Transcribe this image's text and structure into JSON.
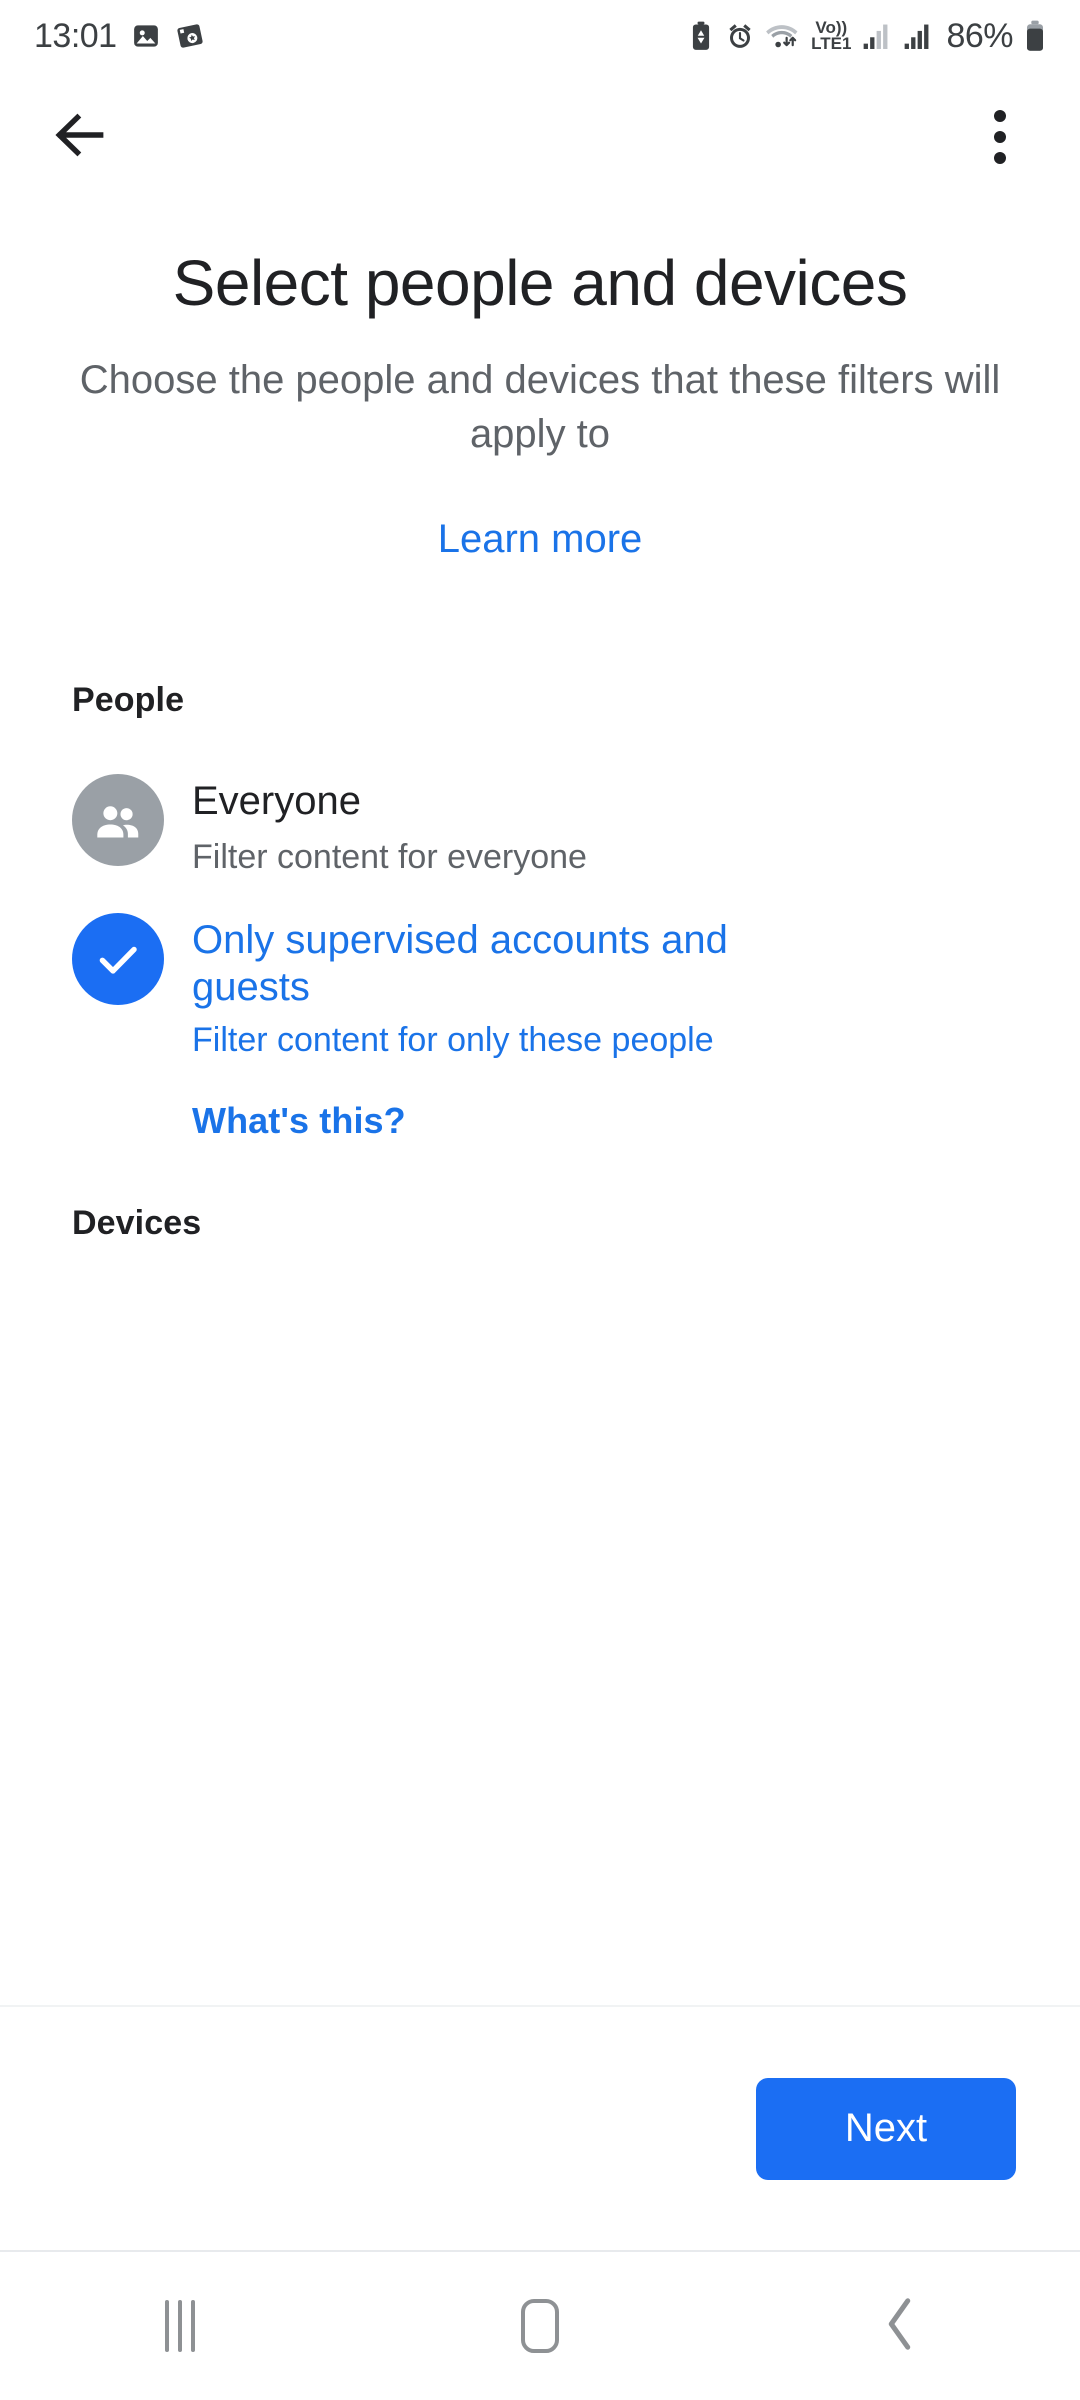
{
  "status_bar": {
    "time": "13:01",
    "battery_percent": "86%",
    "left_icons": [
      "photo-icon",
      "screenshot-capture-icon"
    ],
    "right_icons": [
      "battery-saver-icon",
      "alarm-icon",
      "wifi-icon",
      "volte-icon",
      "signal-sim1-icon",
      "signal-sim2-icon",
      "battery-icon"
    ],
    "network_label": "Vo))",
    "network_label2": "LTE1"
  },
  "toolbar": {
    "back_icon": "back-arrow-icon",
    "overflow_icon": "overflow-menu-icon"
  },
  "header": {
    "title": "Select people and devices",
    "subtitle": "Choose the people and devices that these filters will apply to",
    "learn_more_label": "Learn more"
  },
  "people_section": {
    "heading": "People",
    "options": [
      {
        "title": "Everyone",
        "subtitle": "Filter content for everyone",
        "icon": "group-people-icon",
        "selected": false
      },
      {
        "title": "Only supervised accounts and guests",
        "subtitle": "Filter content for only these people",
        "icon": "check-icon",
        "selected": true
      }
    ],
    "whats_this_label": "What's this?"
  },
  "devices_section": {
    "heading": "Devices"
  },
  "action_bar": {
    "next_label": "Next"
  },
  "nav_bar": {
    "recents_label": "recents-icon",
    "home_label": "home-icon",
    "back_label": "back-icon"
  },
  "colors": {
    "accent_blue": "#1a73e8",
    "button_blue": "#1b6ef3",
    "grey_avatar": "#9aa0a6",
    "text_primary": "#202124",
    "text_secondary": "#5f6368"
  }
}
